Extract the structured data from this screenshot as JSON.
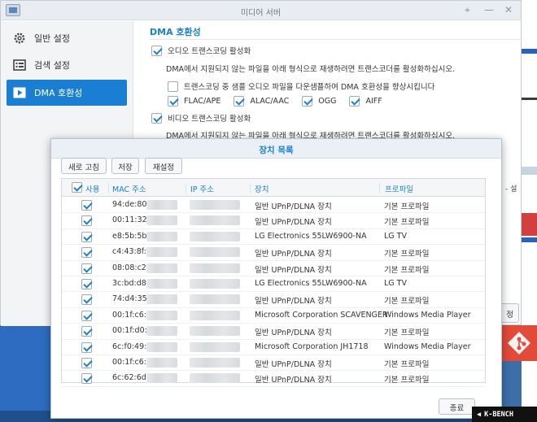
{
  "window": {
    "title": "미디어 서버",
    "controls": {
      "pin": "⌖",
      "minimize": "—",
      "close": "✕"
    }
  },
  "sidebar": {
    "items": [
      {
        "label": "일반 설정",
        "icon": "gear-icon"
      },
      {
        "label": "검색 설정",
        "icon": "list-icon"
      },
      {
        "label": "DMA 호환성",
        "icon": "play-icon",
        "active": true
      }
    ]
  },
  "content": {
    "section_title": "DMA 호환성",
    "audio_transcode": {
      "label": "오디오 트랜스코딩 활성화",
      "checked": true
    },
    "audio_desc": "DMA에서 지원되지 않는 파일을 아래 형식으로 재생하려면 트랜스코더를 활성화하십시오.",
    "downsample": {
      "label": "트랜스코딩 중 샘플 오디오 파일을 다운샘플하여 DMA 호환성을 향상시킵니다",
      "checked": false
    },
    "formats": [
      {
        "label": "FLAC/APE",
        "checked": true
      },
      {
        "label": "ALAC/AAC",
        "checked": true
      },
      {
        "label": "OGG",
        "checked": true
      },
      {
        "label": "AIFF",
        "checked": true
      }
    ],
    "video_transcode": {
      "label": "비디오 트랜스코딩 활성화",
      "checked": true
    },
    "video_desc": "DMA에서 지원되지 않는 파일을 아래 형식으로 재생하려면 트랜스코더를 활성화하십시오.",
    "peek_text": "- 설",
    "apply_label": "정"
  },
  "modal": {
    "title": "장치 목록",
    "toolbar": {
      "refresh": "새로 고침",
      "save": "저장",
      "reset": "재설정"
    },
    "columns": {
      "use": "사용",
      "mac": "MAC 주소",
      "ip": "IP 주소",
      "device": "장치",
      "profile": "프로파일"
    },
    "rows": [
      {
        "mac": "94:de:80",
        "device": "일반 UPnP/DLNA 장치",
        "profile": "기본 프로파일"
      },
      {
        "mac": "00:11:32",
        "device": "일반 UPnP/DLNA 장치",
        "profile": "기본 프로파일"
      },
      {
        "mac": "e8:5b:5b",
        "device": "LG Electronics 55LW6900-NA",
        "profile": "LG TV"
      },
      {
        "mac": "c4:43:8f:",
        "device": "일반 UPnP/DLNA 장치",
        "profile": "기본 프로파일"
      },
      {
        "mac": "08:08:c2",
        "device": "일반 UPnP/DLNA 장치",
        "profile": "기본 프로파일"
      },
      {
        "mac": "3c:bd:d8",
        "device": "LG Electronics 55LW6900-NA",
        "profile": "LG TV"
      },
      {
        "mac": "74:d4:35",
        "device": "일반 UPnP/DLNA 장치",
        "profile": "기본 프로파일"
      },
      {
        "mac": "00:1f:c6:",
        "device": "Microsoft Corporation SCAVENGER",
        "profile": "Windows Media Player"
      },
      {
        "mac": "00:1f:d0:",
        "device": "일반 UPnP/DLNA 장치",
        "profile": "기본 프로파일"
      },
      {
        "mac": "6c:f0:49:",
        "device": "Microsoft Corporation JH1718",
        "profile": "Windows Media Player"
      },
      {
        "mac": "00:1f:c6:",
        "device": "일반 UPnP/DLNA 장치",
        "profile": "기본 프로파일"
      },
      {
        "mac": "6c:62:6d:",
        "device": "일반 UPnP/DLNA 장치",
        "profile": "기본 프로파일"
      }
    ],
    "close_label": "종료"
  },
  "watermark": "K-BENCH",
  "colors": {
    "accent": "#1a7fd2",
    "desktop": "#3d6ea8"
  }
}
